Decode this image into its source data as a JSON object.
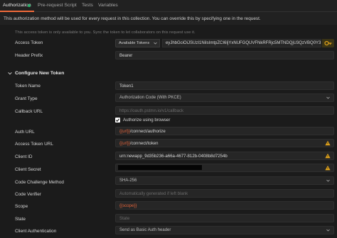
{
  "tabs": [
    "Authorization",
    "Pre-request Script",
    "Tests",
    "Variables"
  ],
  "description": "This authorization method will be used for every request in this collection. You can override this by specifying one in the request.",
  "hint": "This access token is only available to you. Sync the token to let collaborators on this request use it.",
  "access_token": {
    "label": "Access Token",
    "select": "Available Tokens",
    "value": "eyJhbGciOiJSUzI1NiIsImtpZCI6IjYxNUFGQUVFNkRFRjc5MTNDQjU3QzVBQ0Y3R"
  },
  "header_prefix": {
    "label": "Header Prefix",
    "value": "Bearer"
  },
  "section_title": "Configure New Token",
  "token_name": {
    "label": "Token Name",
    "value": "Token1"
  },
  "grant_type": {
    "label": "Grant Type",
    "value": "Authorization Code (With PKCE)"
  },
  "callback_url": {
    "label": "Callback URL",
    "value": "https://oauth.pstmn.io/v1/callback"
  },
  "authorize_browser": {
    "label": "Authorize using browser",
    "checked": true
  },
  "auth_url": {
    "label": "Auth URL",
    "var": "{{url}}",
    "rest": "/connect/authorize"
  },
  "access_token_url": {
    "label": "Access Token URL",
    "var": "{{url}}",
    "rest": "/connect/token"
  },
  "client_id": {
    "label": "Client ID",
    "value": "urn:newapp_9d35b236-a66a-4677-812b-0408b8d7254b"
  },
  "client_secret": {
    "label": "Client Secret"
  },
  "code_challenge_method": {
    "label": "Code Challenge Method",
    "value": "SHA-256"
  },
  "code_verifier": {
    "label": "Code Verifier",
    "placeholder": "Automatically generated if left blank"
  },
  "scope": {
    "label": "Scope",
    "value": "{{scope}}"
  },
  "state": {
    "label": "State",
    "placeholder": "State"
  },
  "client_authentication": {
    "label": "Client Authentication",
    "value": "Send as Basic Auth header"
  },
  "colors": {
    "accent": "#f26b3a",
    "success": "#29b36b",
    "warning": "#e0a21a"
  },
  "icons": [
    "chevron-down-icon",
    "warning-icon",
    "key-icon",
    "checkmark-icon"
  ]
}
